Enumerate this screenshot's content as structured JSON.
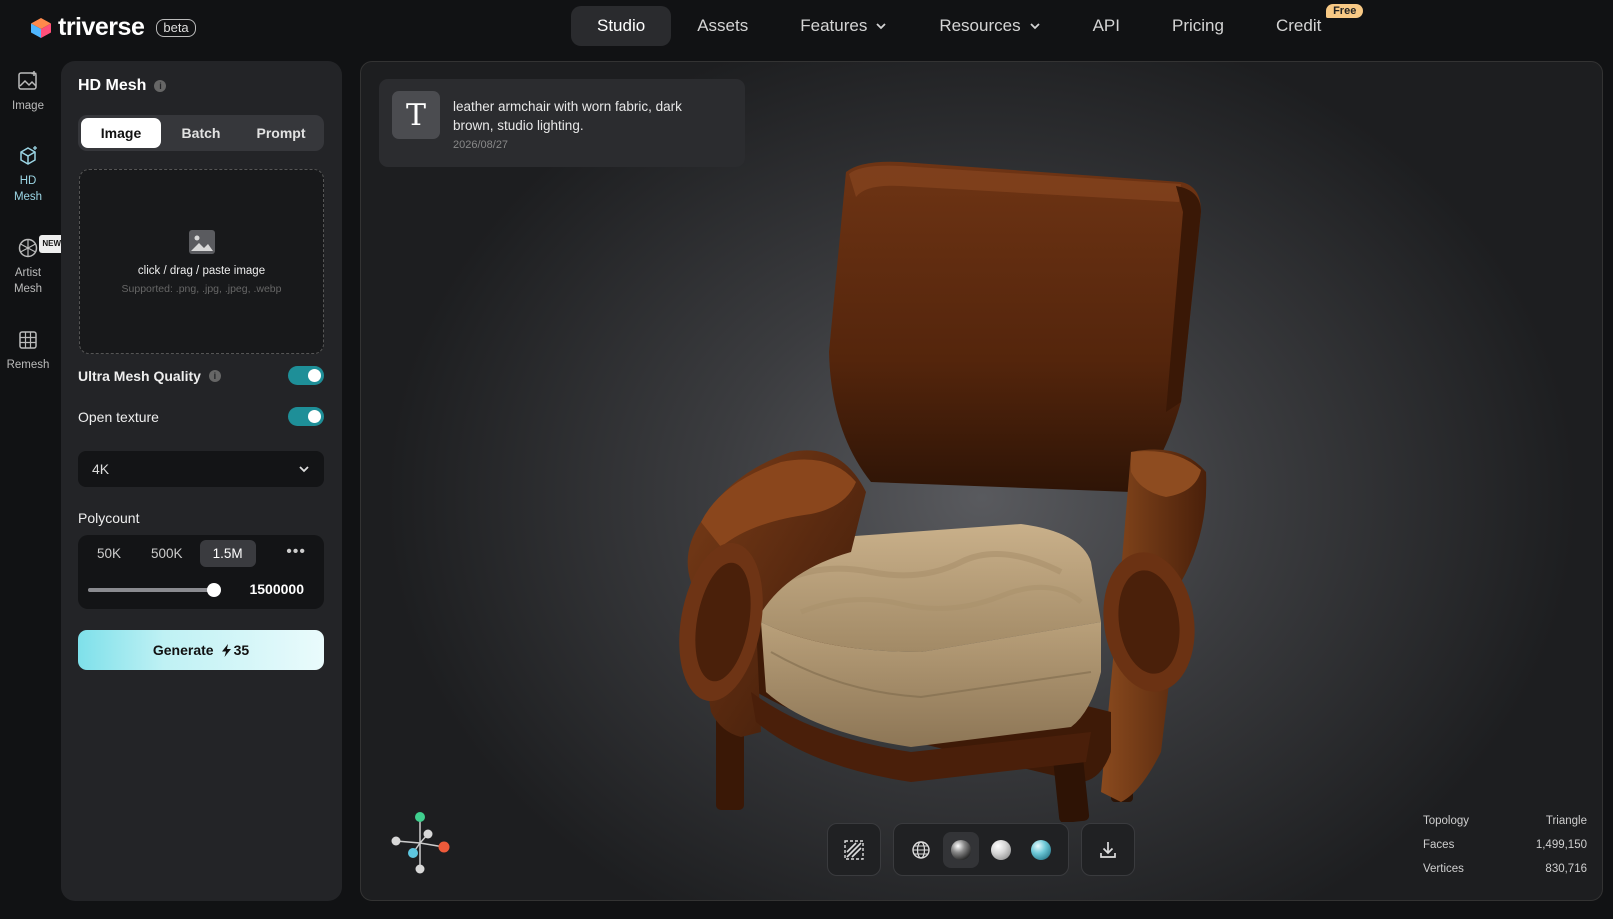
{
  "brand": {
    "name": "triverse",
    "badge": "beta"
  },
  "nav": {
    "items": [
      {
        "label": "Studio"
      },
      {
        "label": "Assets"
      },
      {
        "label": "Features"
      },
      {
        "label": "Resources"
      },
      {
        "label": "API"
      },
      {
        "label": "Pricing"
      },
      {
        "label": "Credit",
        "badge": "Free"
      }
    ]
  },
  "rail": {
    "items": [
      {
        "label": "Image",
        "icon": "image-icon"
      },
      {
        "label": "HD Mesh",
        "icon": "hd-mesh-icon",
        "active": true
      },
      {
        "label": "Artist Mesh",
        "icon": "artist-mesh-icon",
        "badge": "NEW"
      },
      {
        "label": "Remesh",
        "icon": "remesh-icon"
      }
    ]
  },
  "panel": {
    "title": "HD Mesh",
    "tabs": [
      "Image",
      "Batch",
      "Prompt"
    ],
    "active_tab": "Image",
    "upload": {
      "main": "click / drag / paste image",
      "sub": "Supported: .png, .jpg, .jpeg, .webp"
    },
    "ultra_mesh": {
      "label": "Ultra Mesh Quality",
      "on": true
    },
    "open_texture": {
      "label": "Open texture",
      "on": true
    },
    "texture_resolution": "4K",
    "polycount": {
      "label": "Polycount",
      "options": [
        "50K",
        "500K",
        "1.5M"
      ],
      "active": "1.5M",
      "value": "1500000",
      "slider_fraction": 1.0
    },
    "generate": {
      "label": "Generate",
      "cost": "35"
    }
  },
  "viewport": {
    "prompt": {
      "text": "leather armchair with worn fabric, dark brown, studio lighting.",
      "date": "2026/08/27"
    },
    "stats": [
      {
        "label": "Topology",
        "value": "Triangle"
      },
      {
        "label": "Faces",
        "value": "1,499,150"
      },
      {
        "label": "Vertices",
        "value": "830,716"
      }
    ]
  },
  "colors": {
    "accent": "#1e8f98",
    "generate_gradient_start": "#7ee0ea",
    "free_badge": "#f8c985",
    "background": "#111214"
  }
}
